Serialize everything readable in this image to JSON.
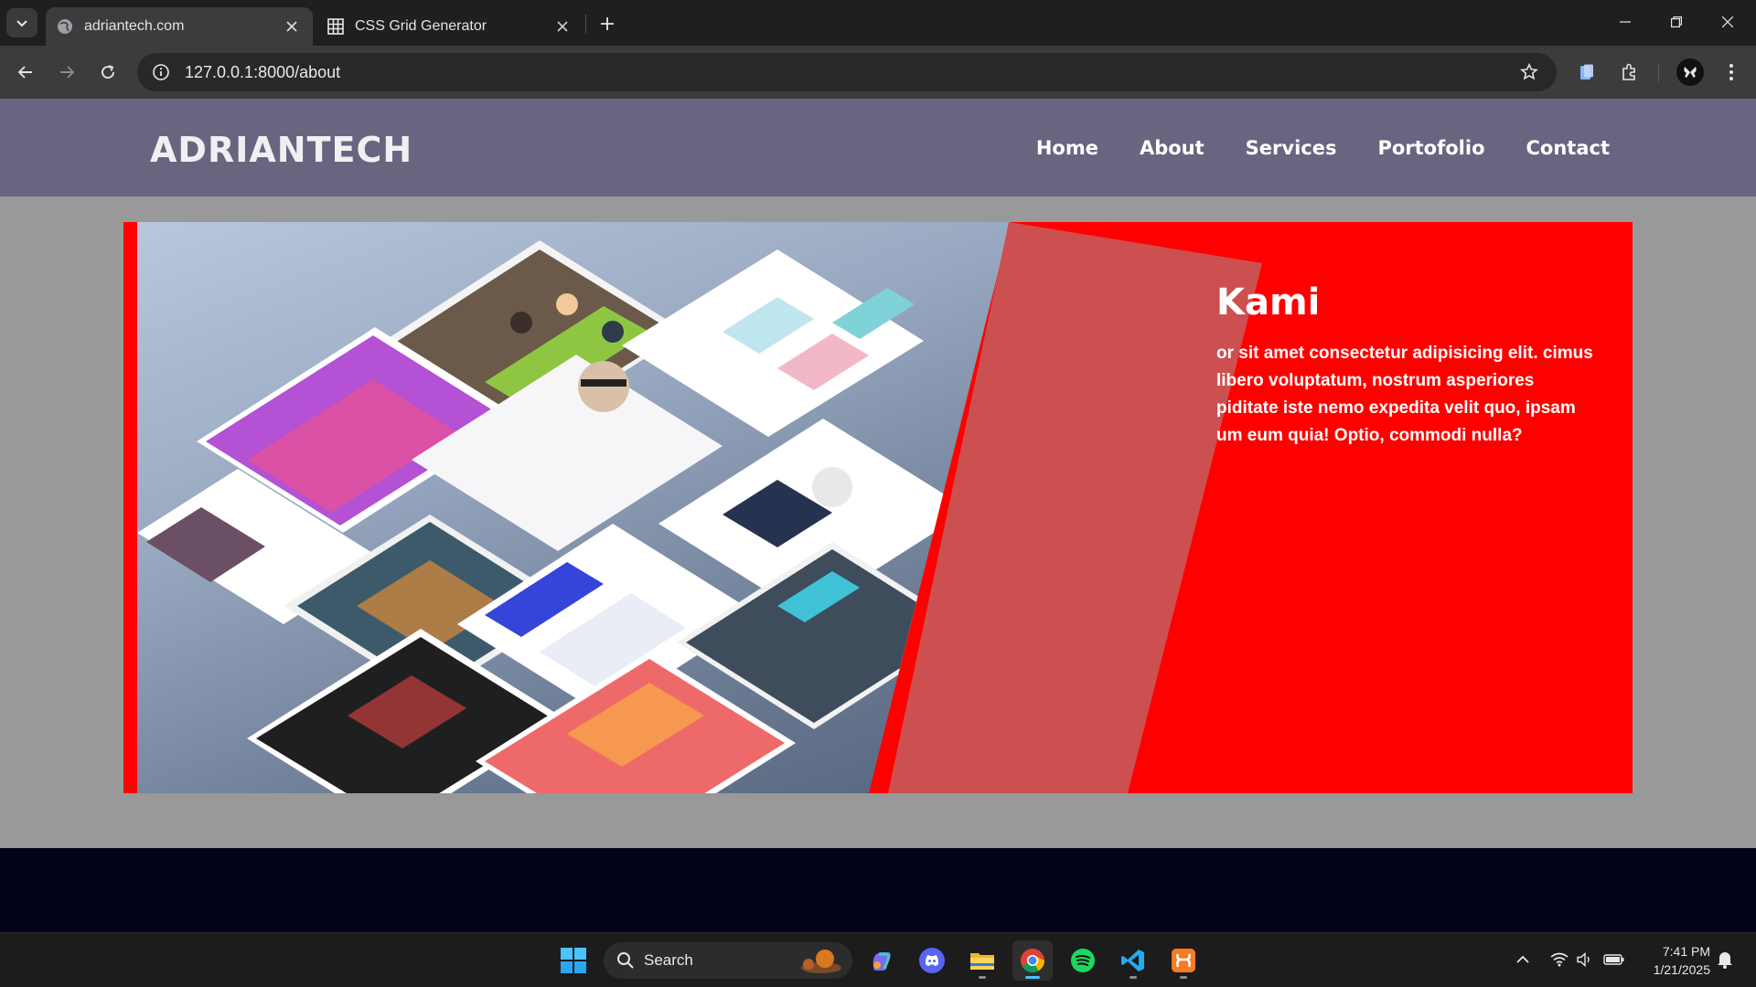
{
  "browser": {
    "tabs": [
      {
        "title": "adriantech.com",
        "active": true
      },
      {
        "title": "CSS Grid Generator",
        "active": false
      }
    ],
    "url": "127.0.0.1:8000/about"
  },
  "site": {
    "logo": "ADRIANTECH",
    "nav": [
      "Home",
      "About",
      "Services",
      "Portofolio",
      "Contact"
    ],
    "about": {
      "title": "Kami",
      "body": "or sit amet consectetur adipisicing elit. cimus libero voluptatum, nostrum asperiores piditate iste nemo expedita velit quo, ipsam um eum quia! Optio, commodi nulla?"
    },
    "colors": {
      "header": "#696580",
      "page_bg": "#999999",
      "card": "#ff0000",
      "footer": "#02021a"
    }
  },
  "taskbar": {
    "search_label": "Search",
    "apps": [
      "windows-start",
      "copilot",
      "discord",
      "file-explorer",
      "chrome",
      "spotify",
      "vscode",
      "xampp"
    ],
    "time": "7:41 PM",
    "date": "1/21/2025"
  }
}
